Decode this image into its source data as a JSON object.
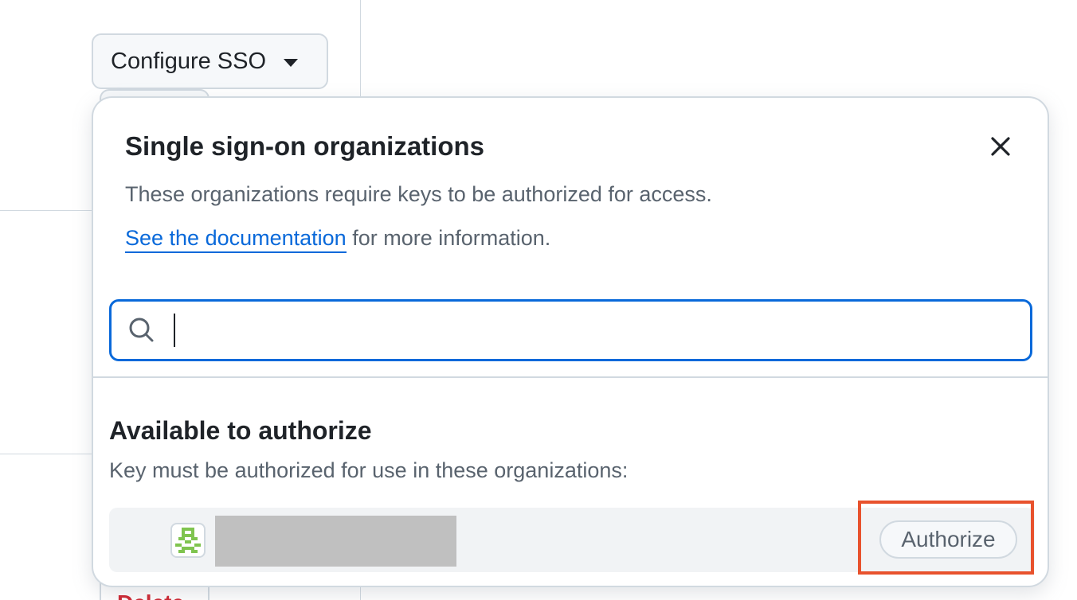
{
  "background": {
    "configure_button_label": "Configure SSO",
    "delete_peek_label": "Delete"
  },
  "dialog": {
    "title": "Single sign-on organizations",
    "description": "These organizations require keys to be authorized for access.",
    "doc_link_text": "See the documentation",
    "doc_suffix": " for more information.",
    "search": {
      "value": "",
      "placeholder": ""
    },
    "section_title": "Available to authorize",
    "section_subtitle": "Key must be authorized for use in these organizations:",
    "organizations": [
      {
        "authorize_label": "Authorize"
      }
    ]
  },
  "icons": {
    "close": "close-icon",
    "search": "search-icon",
    "caret": "caret-down-icon",
    "org_avatar": "org-avatar-icon"
  },
  "colors": {
    "link": "#0969da",
    "focus_border": "#0969da",
    "highlight": "#e8522d",
    "muted_text": "#59636e",
    "danger": "#cf222e"
  }
}
